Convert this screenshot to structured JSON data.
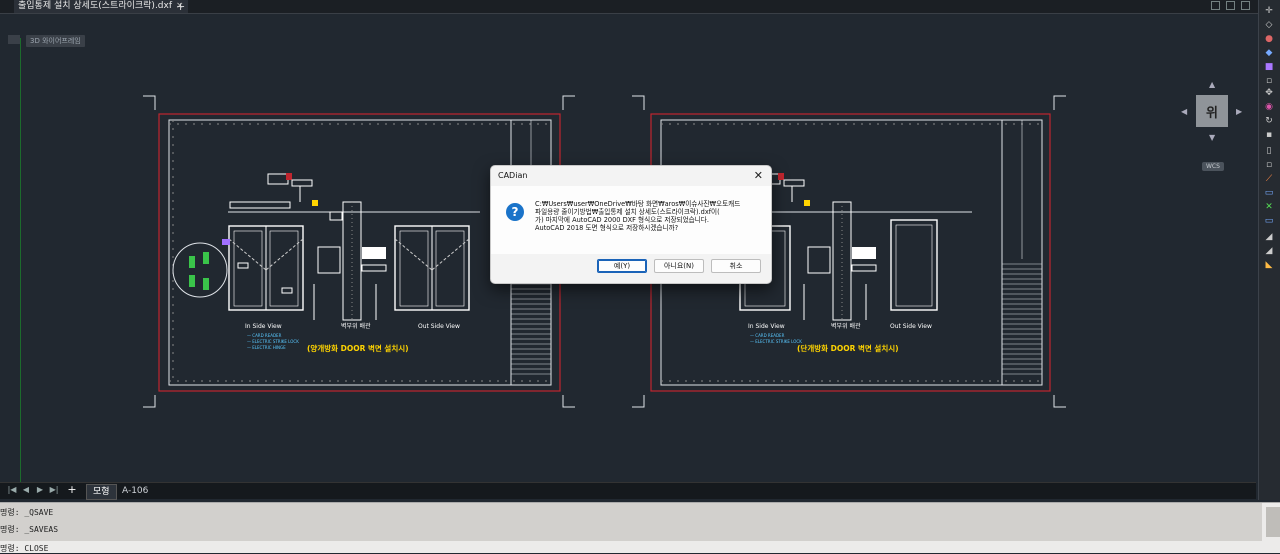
{
  "document_tab": {
    "title": "출입통제 설치 상세도(스트라이크락).dxf",
    "close": "×",
    "add": "+"
  },
  "viewport": {
    "label": "3D 와이어프레임"
  },
  "viewcube": {
    "face": "위",
    "wcs": "WCS",
    "arrows": {
      "up": "▲",
      "down": "▼",
      "left": "◀",
      "right": "▶"
    }
  },
  "layout_tabs": {
    "nav": [
      "|◀",
      "◀",
      "▶",
      "▶|"
    ],
    "add": "+",
    "tabs": [
      "모형",
      "A-106"
    ]
  },
  "drawing": {
    "left": {
      "title": "(양개방화 DOOR 벽면 설치시)",
      "labels": [
        "In Side View",
        "벽부위 배관",
        "Out Side View"
      ],
      "legend": [
        "— CARD READER",
        "— ELECTRIC STRIKE LOCK",
        "— ELECTRIC HINGE"
      ]
    },
    "right": {
      "title": "(단개방화 DOOR 벽면 설치시)",
      "labels": [
        "In Side View",
        "벽부위 배관",
        "Out Side View"
      ],
      "legend": [
        "— CARD READER",
        "— ELECTRIC STRIKE LOCK"
      ]
    }
  },
  "dialog": {
    "title": "CADian",
    "close_icon": "✕",
    "icon": "?",
    "message_lines": [
      "C:₩Users₩user₩OneDrive₩바탕 화면₩aros₩이슈사진₩오토캐드",
      "파일용량 줄이기방법₩출입통제 설치 상세도(스트라이크락).dxf이(",
      "가) 마지막에 AutoCAD 2000 DXF 형식으로 저장되었습니다.",
      "AutoCAD 2018 도면 형식으로 저장하시겠습니까?"
    ],
    "buttons": {
      "yes": "예(Y)",
      "no": "아니요(N)",
      "cancel": "취소"
    }
  },
  "command_history": [
    "명령: _QSAVE",
    "명령: _SAVEAS",
    "명령: CLOSE"
  ],
  "command_prompt": "명령:",
  "colors": {
    "bg": "#212830",
    "frame_red": "#c0262f",
    "title_yellow": "#ffd400",
    "legend_cyan": "#59c8ff"
  }
}
